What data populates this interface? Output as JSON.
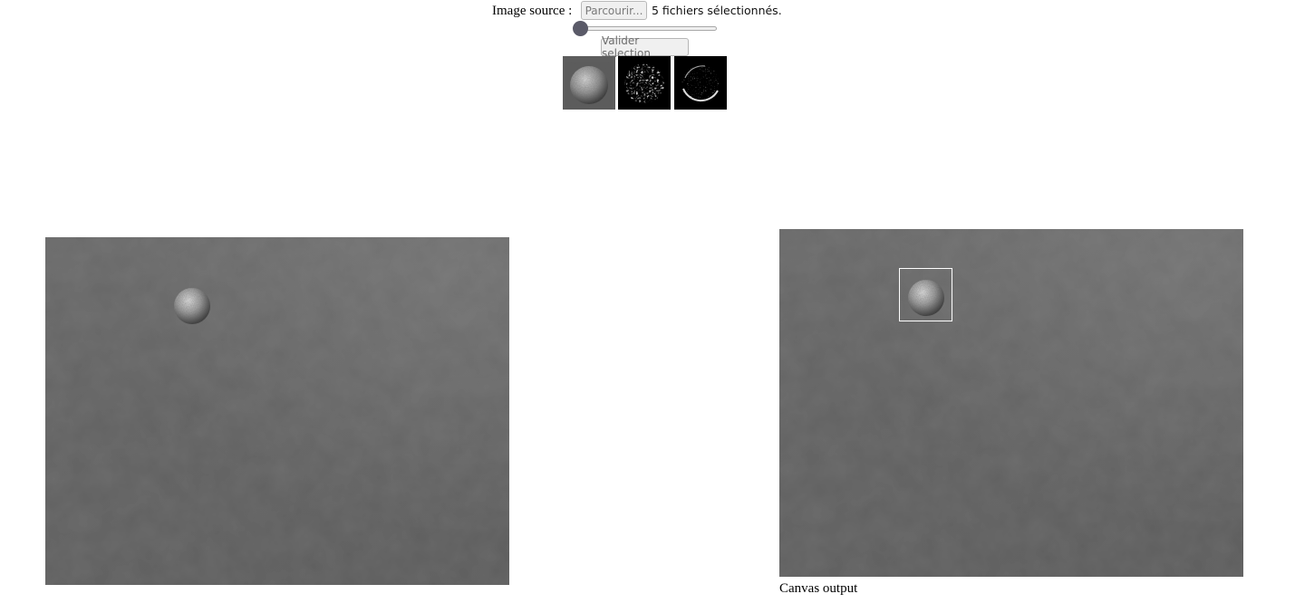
{
  "controls": {
    "source_label": "Image source :",
    "browse_label": "Parcourir...",
    "files_status": "5 fichiers sélectionnés.",
    "slider_value": 0,
    "validate_label": "Valider selection"
  },
  "thumbnails": [
    {
      "kind": "original-sphere"
    },
    {
      "kind": "edge-filter"
    },
    {
      "kind": "gradient-filter"
    }
  ],
  "output": {
    "caption": "Canvas output"
  }
}
